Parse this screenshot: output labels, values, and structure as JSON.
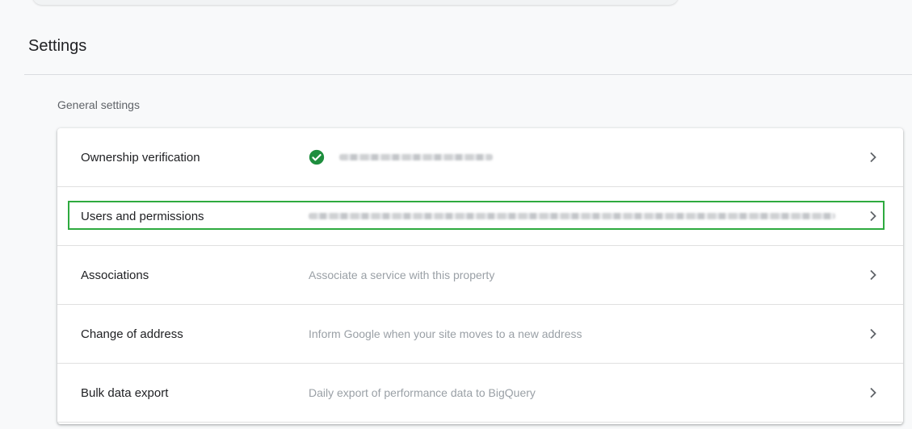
{
  "page": {
    "title": "Settings"
  },
  "general": {
    "section_label": "General settings",
    "rows": [
      {
        "label": "Ownership verification",
        "desc": "",
        "status": "verified"
      },
      {
        "label": "Users and permissions",
        "desc": ""
      },
      {
        "label": "Associations",
        "desc": "Associate a service with this property"
      },
      {
        "label": "Change of address",
        "desc": "Inform Google when your site moves to a new address"
      },
      {
        "label": "Bulk data export",
        "desc": "Daily export of performance data to BigQuery"
      }
    ]
  },
  "colors": {
    "highlight": "#2eaa3f",
    "check": "#1e8e3e"
  },
  "icons": {
    "row_action": "chevron-right-icon",
    "status": "check-circle-icon"
  }
}
